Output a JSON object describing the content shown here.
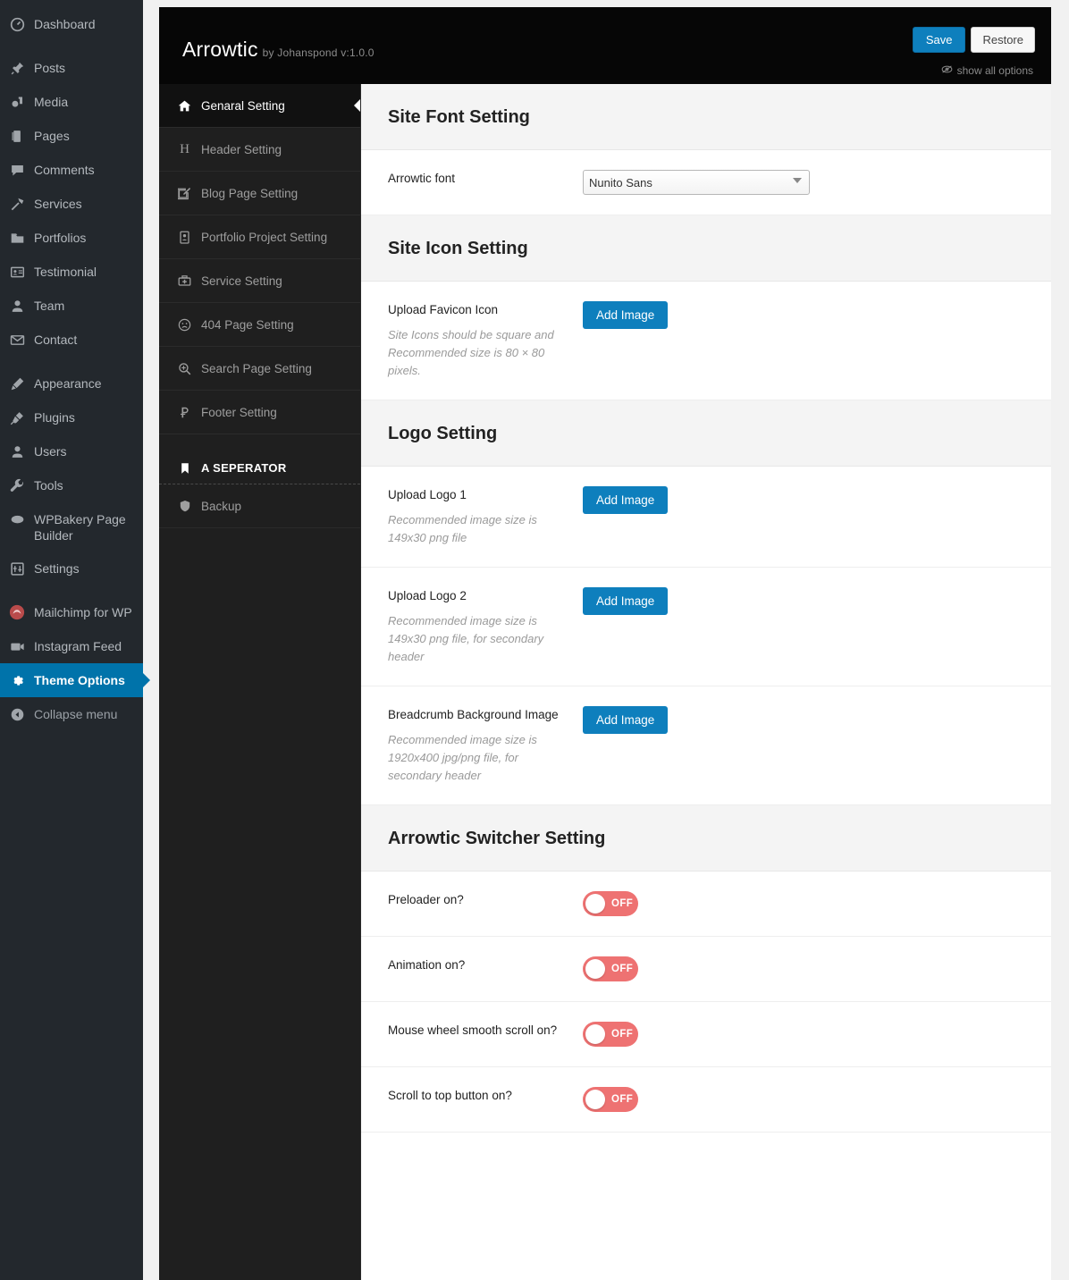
{
  "wp_sidebar": {
    "items": [
      {
        "label": "Dashboard",
        "icon": "dashboard-icon",
        "active": false,
        "gap_after": true
      },
      {
        "label": "Posts",
        "icon": "pin-icon",
        "active": false,
        "gap_after": false
      },
      {
        "label": "Media",
        "icon": "media-icon",
        "active": false,
        "gap_after": false
      },
      {
        "label": "Pages",
        "icon": "pages-icon",
        "active": false,
        "gap_after": false
      },
      {
        "label": "Comments",
        "icon": "comments-icon",
        "active": false,
        "gap_after": false
      },
      {
        "label": "Services",
        "icon": "hammer-icon",
        "active": false,
        "gap_after": false
      },
      {
        "label": "Portfolios",
        "icon": "portfolio-icon",
        "active": false,
        "gap_after": false
      },
      {
        "label": "Testimonial",
        "icon": "testimonial-icon",
        "active": false,
        "gap_after": false
      },
      {
        "label": "Team",
        "icon": "user-icon",
        "active": false,
        "gap_after": false
      },
      {
        "label": "Contact",
        "icon": "envelope-icon",
        "active": false,
        "gap_after": true
      },
      {
        "label": "Appearance",
        "icon": "appearance-brush-icon",
        "active": false,
        "gap_after": false
      },
      {
        "label": "Plugins",
        "icon": "plug-icon",
        "active": false,
        "gap_after": false
      },
      {
        "label": "Users",
        "icon": "users-icon",
        "active": false,
        "gap_after": false
      },
      {
        "label": "Tools",
        "icon": "wrench-icon",
        "active": false,
        "gap_after": false
      },
      {
        "label": "WPBakery Page Builder",
        "icon": "wpbakery-icon",
        "active": false,
        "gap_after": false
      },
      {
        "label": "Settings",
        "icon": "settings-sliders-icon",
        "active": false,
        "gap_after": true
      },
      {
        "label": "Mailchimp for WP",
        "icon": "mailchimp-icon",
        "active": false,
        "gap_after": false
      },
      {
        "label": "Instagram Feed",
        "icon": "camera-icon",
        "active": false,
        "gap_after": false
      },
      {
        "label": "Theme Options",
        "icon": "gear-icon",
        "active": true,
        "gap_after": false
      },
      {
        "label": "Collapse menu",
        "icon": "collapse-arrow-icon",
        "active": false,
        "gap_after": false
      }
    ]
  },
  "header": {
    "title": "Arrowtic",
    "subtitle": "by Johanspond v:1.0.0",
    "save_label": "Save",
    "restore_label": "Restore",
    "show_all_label": "show all options",
    "accent_color": "#0e7fbd",
    "background_color": "#060606"
  },
  "tabnav": {
    "items": [
      {
        "label": "Genaral Setting",
        "icon": "home-icon",
        "active": true,
        "separator": false
      },
      {
        "label": "Header Setting",
        "icon": "heading-h-icon",
        "active": false,
        "separator": false
      },
      {
        "label": "Blog Page Setting",
        "icon": "pencil-square-icon",
        "active": false,
        "separator": false
      },
      {
        "label": "Portfolio Project Setting",
        "icon": "id-card-icon",
        "active": false,
        "separator": false
      },
      {
        "label": "Service Setting",
        "icon": "medkit-icon",
        "active": false,
        "separator": false
      },
      {
        "label": "404 Page Setting",
        "icon": "frown-face-icon",
        "active": false,
        "separator": false
      },
      {
        "label": "Search Page Setting",
        "icon": "search-plus-icon",
        "active": false,
        "separator": false
      },
      {
        "label": "Footer Setting",
        "icon": "ruble-p-icon",
        "active": false,
        "separator": false
      },
      {
        "label": "A SEPERATOR",
        "icon": "bookmark-icon",
        "active": false,
        "separator": true
      },
      {
        "label": "Backup",
        "icon": "shield-icon",
        "active": false,
        "separator": false
      }
    ]
  },
  "content": {
    "sections": [
      {
        "title": "Site Font Setting",
        "fields": [
          {
            "kind": "select",
            "title": "Arrowtic font",
            "desc": "",
            "value": "Nunito Sans",
            "options": [
              "Nunito Sans"
            ]
          }
        ]
      },
      {
        "title": "Site Icon Setting",
        "fields": [
          {
            "kind": "upload",
            "title": "Upload Favicon Icon",
            "desc": "Site Icons should be square and Recommended size is 80 × 80 pixels.",
            "button_label": "Add Image"
          }
        ]
      },
      {
        "title": "Logo Setting",
        "fields": [
          {
            "kind": "upload",
            "title": "Upload Logo 1",
            "desc": "Recommended image size is 149x30 png file",
            "button_label": "Add Image"
          },
          {
            "kind": "upload",
            "title": "Upload Logo 2",
            "desc": "Recommended image size is 149x30 png file, for secondary header",
            "button_label": "Add Image"
          },
          {
            "kind": "upload",
            "title": "Breadcrumb Background Image",
            "desc": "Recommended image size is 1920x400 jpg/png file, for secondary header",
            "button_label": "Add Image"
          }
        ]
      },
      {
        "title": "Arrowtic Switcher Setting",
        "fields": [
          {
            "kind": "toggle",
            "title": "Preloader on?",
            "desc": "",
            "state": "OFF"
          },
          {
            "kind": "toggle",
            "title": "Animation on?",
            "desc": "",
            "state": "OFF"
          },
          {
            "kind": "toggle",
            "title": "Mouse wheel smooth scroll on?",
            "desc": "",
            "state": "OFF"
          },
          {
            "kind": "toggle",
            "title": "Scroll to top button on?",
            "desc": "",
            "state": "OFF"
          }
        ]
      }
    ]
  },
  "colors": {
    "toggle_off": "#ee7272",
    "wp_sidebar_bg": "#23282d",
    "wp_active": "#0073aa",
    "tabnav_bg": "#1f1f1f"
  }
}
